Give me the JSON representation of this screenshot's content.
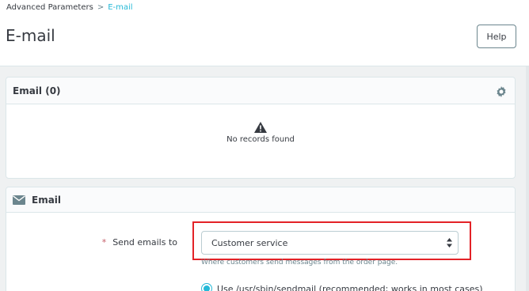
{
  "breadcrumb": {
    "parent": "Advanced Parameters",
    "separator": ">",
    "current": "E-mail"
  },
  "page": {
    "title": "E-mail",
    "help_label": "Help"
  },
  "email_list": {
    "heading": "Email (0)",
    "empty_text": "No records found",
    "icons": [
      "gear-icon",
      "warning-icon"
    ]
  },
  "email_form": {
    "heading": "Email",
    "icon": "envelope-icon",
    "send_to": {
      "required_mark": "*",
      "label": "Send emails to",
      "value": "Customer service",
      "hint": "Where customers send messages from the order page."
    },
    "method": {
      "selected_label": "Use /usr/sbin/sendmail (recommended; works in most cases)"
    }
  },
  "colors": {
    "accent": "#25b9d7",
    "highlight": "#e32227",
    "required": "#c45c67"
  }
}
